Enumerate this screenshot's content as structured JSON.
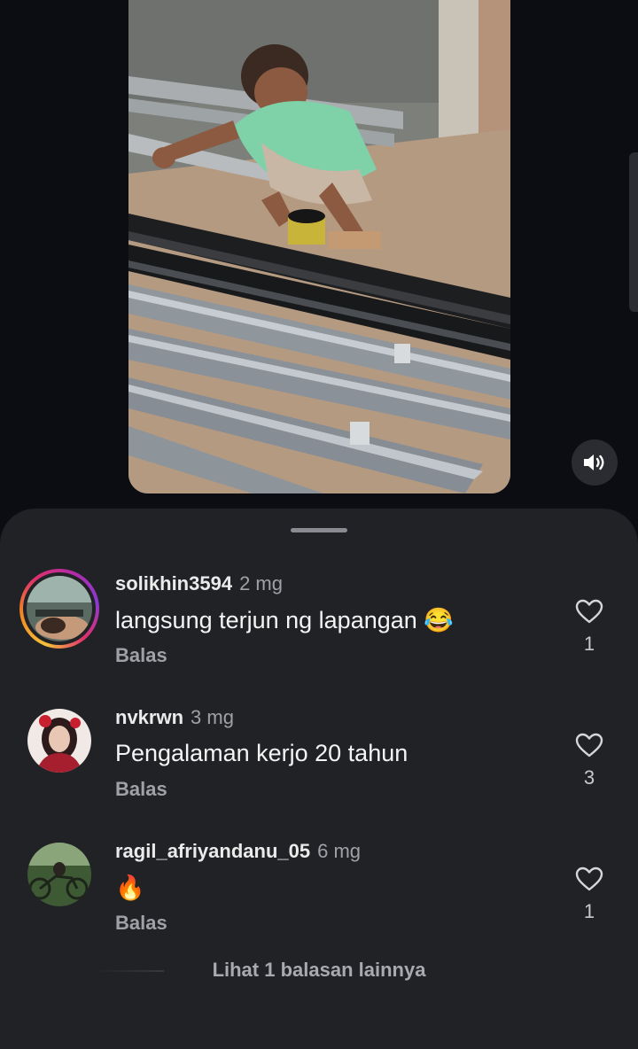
{
  "comments": [
    {
      "username": "solikhin3594",
      "time": "2 mg",
      "text": "langsung terjun ng lapangan 😂",
      "reply_label": "Balas",
      "likes": "1",
      "has_story_ring": true
    },
    {
      "username": "nvkrwn",
      "time": "3 mg",
      "text": "Pengalaman kerjo 20 tahun",
      "reply_label": "Balas",
      "likes": "3",
      "has_story_ring": false
    },
    {
      "username": "ragil_afriyandanu_05",
      "time": "6 mg",
      "text": "🔥",
      "reply_label": "Balas",
      "likes": "1",
      "has_story_ring": false
    }
  ],
  "more_replies_label": "Lihat 1 balasan lainnya",
  "icons": {
    "mute": "speaker-icon",
    "like": "heart-outline-icon"
  }
}
